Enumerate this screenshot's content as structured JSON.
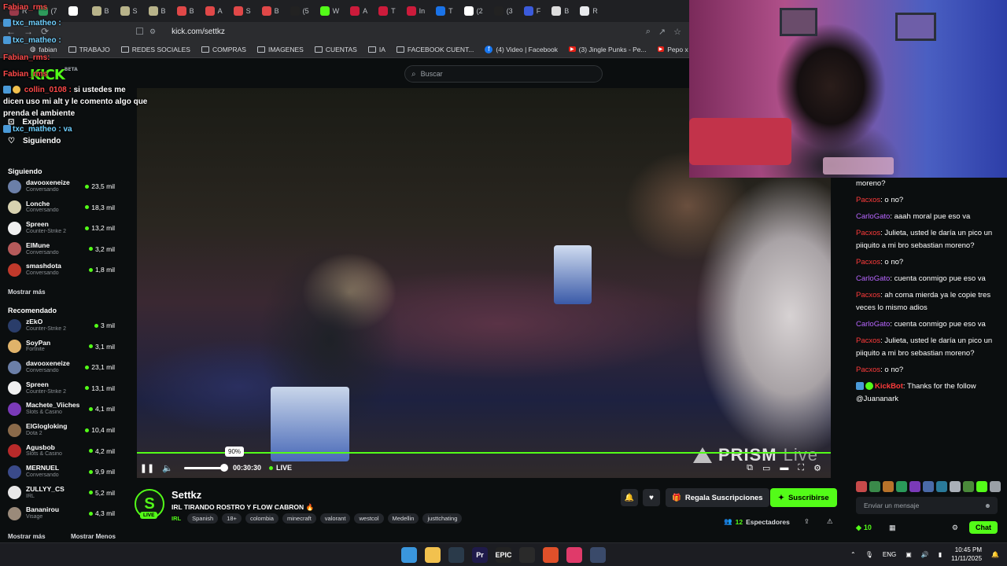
{
  "browser": {
    "tabs": [
      {
        "label": "R",
        "color": "#9b3a4a"
      },
      {
        "label": "(7",
        "color": "#2e9a5b"
      },
      {
        "label": "",
        "color": "#ffffff"
      },
      {
        "label": "B",
        "color": "#b8b38a"
      },
      {
        "label": "S",
        "color": "#b8b38a"
      },
      {
        "label": "B",
        "color": "#b8b38a"
      },
      {
        "label": "B",
        "color": "#e04848"
      },
      {
        "label": "A",
        "color": "#e04848"
      },
      {
        "label": "S",
        "color": "#e04848"
      },
      {
        "label": "B",
        "color": "#e04848"
      },
      {
        "label": "(5",
        "color": "#222222"
      },
      {
        "label": "W",
        "color": "#53fc18"
      },
      {
        "label": "A",
        "color": "#cc1b3b"
      },
      {
        "label": "T",
        "color": "#cc1b3b"
      },
      {
        "label": "In",
        "color": "#cc1b3b"
      },
      {
        "label": "T",
        "color": "#1a73e8"
      },
      {
        "label": "(2",
        "color": "#ffffff"
      },
      {
        "label": "(3",
        "color": "#222222"
      },
      {
        "label": "F",
        "color": "#3b5bdb"
      },
      {
        "label": "B",
        "color": "#dddddd"
      },
      {
        "label": "R",
        "color": "#e8eaed"
      }
    ],
    "url": "kick.com/settkz",
    "bookmarks": [
      {
        "label": "fabian",
        "type": "site"
      },
      {
        "label": "TRABAJO",
        "type": "folder"
      },
      {
        "label": "REDES SOCIALES",
        "type": "folder"
      },
      {
        "label": "COMPRAS",
        "type": "folder"
      },
      {
        "label": "IMAGENES",
        "type": "folder"
      },
      {
        "label": "CUENTAS",
        "type": "folder"
      },
      {
        "label": "IA",
        "type": "folder"
      },
      {
        "label": "FACEBOOK CUENT...",
        "type": "folder"
      },
      {
        "label": "(4) Video | Facebook",
        "type": "facebook"
      },
      {
        "label": "(3) Jingle Punks - Pe...",
        "type": "youtube"
      },
      {
        "label": "Pepo x @kazu.oficia...",
        "type": "youtube"
      }
    ]
  },
  "kick": {
    "logo": "KICK",
    "beta": "BETA",
    "search_placeholder": "Buscar"
  },
  "sidebar": {
    "nav": [
      {
        "label": "Explorar",
        "icon": "compass-icon"
      },
      {
        "label": "Siguiendo",
        "icon": "heart-icon"
      }
    ],
    "following_title": "Siguiendo",
    "following": [
      {
        "name": "davooxeneize",
        "category": "Conversando",
        "viewers": "23,5 mil",
        "color": "#6b7fa8"
      },
      {
        "name": "Lonche",
        "category": "Conversando",
        "viewers": "18,3 mil",
        "color": "#d8d2b0"
      },
      {
        "name": "Spreen",
        "category": "Counter-Strike 2",
        "viewers": "13,2 mil",
        "color": "#f0f0f0"
      },
      {
        "name": "ElMune",
        "category": "Conversando",
        "viewers": "3,2 mil",
        "color": "#b55a5a"
      },
      {
        "name": "smashdota",
        "category": "Conversando",
        "viewers": "1,8 mil",
        "color": "#c0392b"
      }
    ],
    "more_following": "Mostrar más",
    "recommended_title": "Recomendado",
    "recommended": [
      {
        "name": "zEkO",
        "category": "Counter-Strike 2",
        "viewers": "3 mil",
        "color": "#2a3d6a"
      },
      {
        "name": "SoyPan",
        "category": "Fortnite",
        "viewers": "3,1 mil",
        "color": "#e0b36a"
      },
      {
        "name": "davooxeneize",
        "category": "Conversando",
        "viewers": "23,1 mil",
        "color": "#6b7fa8"
      },
      {
        "name": "Spreen",
        "category": "Counter-Strike 2",
        "viewers": "13,1 mil",
        "color": "#f0f0f0"
      },
      {
        "name": "Machete_Viiches",
        "category": "Slots & Casino",
        "viewers": "4,1 mil",
        "color": "#7a3ab8"
      },
      {
        "name": "ElGlogloking",
        "category": "Dota 2",
        "viewers": "10,4 mil",
        "color": "#8a6a4a"
      },
      {
        "name": "Agusbob",
        "category": "Slots & Casino",
        "viewers": "4,2 mil",
        "color": "#b82a2a"
      },
      {
        "name": "MERNUEL",
        "category": "Conversando",
        "viewers": "9,9 mil",
        "color": "#3a4a8a"
      },
      {
        "name": "ZULLYY_CS",
        "category": "IRL",
        "viewers": "5,2 mil",
        "color": "#e8e8e8"
      },
      {
        "name": "Bananirou",
        "category": "Visage",
        "viewers": "4,3 mil",
        "color": "#9a8a7a"
      }
    ],
    "more": "Mostrar más",
    "less": "Mostrar Menos"
  },
  "overlay_chat": [
    {
      "text": "Fabian_rms",
      "style": "ov-red"
    },
    {
      "text": "txc_matheo :",
      "style": "ov-cyan"
    },
    {
      "text": "txc_matheo :",
      "style": "ov-cyan"
    },
    {
      "text": "Fabian_rms:",
      "style": "ov-red"
    },
    {
      "text": "Fabian_rms",
      "style": "ov-red"
    },
    {
      "text": "collin_0108 :",
      "style": "ov-red"
    },
    {
      "text": "si ustedes me",
      "style": "ov-white"
    },
    {
      "text": "dicen uso mi alt y le comento algo que",
      "style": "ov-white"
    },
    {
      "text": "prenda el ambiente",
      "style": "ov-white"
    },
    {
      "text": "txc_matheo : va",
      "style": "ov-cyan"
    }
  ],
  "player": {
    "volume_tooltip": "90%",
    "time": "00:30:30",
    "live_label": "LIVE",
    "volume": 0.9,
    "watermark_brand": "PRISM",
    "watermark_suffix": "Live"
  },
  "channel": {
    "avatar_letter": "S",
    "live_badge": "LIVE",
    "name": "Settkz",
    "title": "IRL TIRANDO ROSTRO Y FLOW CABRON 🔥",
    "category": "IRL",
    "tags": [
      "Spanish",
      "18+",
      "colombia",
      "minecraft",
      "valorant",
      "westcol",
      "Medellin",
      "justtchating"
    ],
    "gift_label": "Regala Suscripciones",
    "subscribe_label": "Suscribirse",
    "viewers_count": "12",
    "viewers_label": "Espectadores"
  },
  "chat": {
    "messages": [
      {
        "user": "",
        "text": "moreno?",
        "style": "u-p"
      },
      {
        "user": "Pacxos",
        "text": ": o no?",
        "style": "u-p"
      },
      {
        "user": "CarloGato",
        "text": ": aaah moral pue eso va",
        "style": "u-c"
      },
      {
        "user": "Pacxos",
        "text": ": Julieta, usted le daría un pico un piiquito a mi bro sebastian moreno?",
        "style": "u-p"
      },
      {
        "user": "Pacxos",
        "text": ": o no?",
        "style": "u-p"
      },
      {
        "user": "CarloGato",
        "text": ": cuenta conmigo pue eso va",
        "style": "u-c"
      },
      {
        "user": "Pacxos",
        "text": ": ah coma mierda ya le copie tres veces lo mismo adios",
        "style": "u-p"
      },
      {
        "user": "CarloGato",
        "text": ": cuenta conmigo pue eso va",
        "style": "u-c"
      },
      {
        "user": "Pacxos",
        "text": ": Julieta, usted le daría un pico un piiquito a mi bro sebastian moreno?",
        "style": "u-p"
      },
      {
        "user": "Pacxos",
        "text": ": o no?",
        "style": "u-p"
      },
      {
        "user": "KickBot",
        "text": ": Thanks for the follow @Juananark",
        "style": "u-k"
      }
    ],
    "emote_colors": [
      "#c74a4a",
      "#3a8a4a",
      "#b8732a",
      "#2a9a5a",
      "#7a3ab8",
      "#4a6aa8",
      "#2a7a9a",
      "#aab0b8",
      "#4a8a3a",
      "#53fc18",
      "#9aa0a6"
    ],
    "input_placeholder": "Enviar un mensaje",
    "kicks": "10",
    "chat_button": "Chat"
  },
  "taskbar": {
    "apps": [
      {
        "name": "windows-start-icon",
        "label": "",
        "color": "#3a96dd"
      },
      {
        "name": "file-explorer-icon",
        "label": "",
        "color": "#f2c14e"
      },
      {
        "name": "steam-icon",
        "label": "",
        "color": "#2a3a4a"
      },
      {
        "name": "premiere-icon",
        "label": "Pr",
        "color": "#1f1a4a"
      },
      {
        "name": "epic-games-icon",
        "label": "EPIC",
        "color": "#222222"
      },
      {
        "name": "chrome-icon",
        "label": "",
        "color": "#2a2a2a"
      },
      {
        "name": "brave-icon",
        "label": "",
        "color": "#e0502a"
      },
      {
        "name": "tiktok-icon",
        "label": "",
        "color": "#e03a6a"
      },
      {
        "name": "calculator-icon",
        "label": "",
        "color": "#3a4a6a"
      }
    ],
    "lang": "ENG",
    "time": "10:45 PM",
    "date": "11/11/2025"
  }
}
